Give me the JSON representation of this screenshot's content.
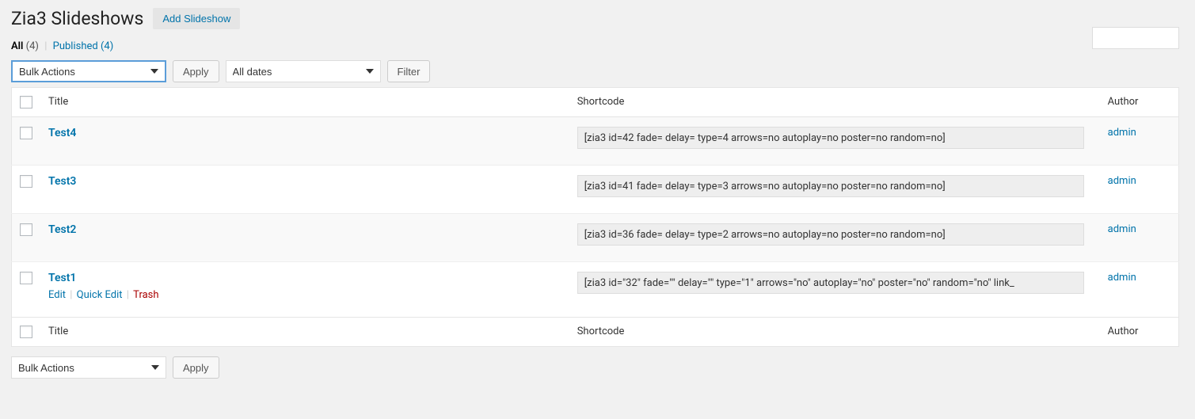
{
  "header": {
    "title": "Zia3 Slideshows",
    "add_button": "Add Slideshow"
  },
  "filters": {
    "all_label": "All",
    "all_count": "(4)",
    "published_label": "Published",
    "published_count": "(4)"
  },
  "tablenav": {
    "bulk_label": "Bulk Actions",
    "apply_label": "Apply",
    "date_label": "All dates",
    "filter_label": "Filter"
  },
  "columns": {
    "title": "Title",
    "shortcode": "Shortcode",
    "author": "Author"
  },
  "rows": [
    {
      "title": "Test4",
      "shortcode": "[zia3 id=42 fade= delay= type=4 arrows=no autoplay=no poster=no random=no]",
      "author": "admin",
      "show_actions": false
    },
    {
      "title": "Test3",
      "shortcode": "[zia3 id=41 fade= delay= type=3 arrows=no autoplay=no poster=no random=no]",
      "author": "admin",
      "show_actions": false
    },
    {
      "title": "Test2",
      "shortcode": "[zia3 id=36 fade= delay= type=2 arrows=no autoplay=no poster=no random=no]",
      "author": "admin",
      "show_actions": false
    },
    {
      "title": "Test1",
      "shortcode": "[zia3 id=\"32\" fade=\"\" delay=\"\" type=\"1\" arrows=\"no\" autoplay=\"no\" poster=\"no\" random=\"no\" link_",
      "author": "admin",
      "show_actions": true
    }
  ],
  "row_actions": {
    "edit": "Edit",
    "quick_edit": "Quick Edit",
    "trash": "Trash"
  }
}
